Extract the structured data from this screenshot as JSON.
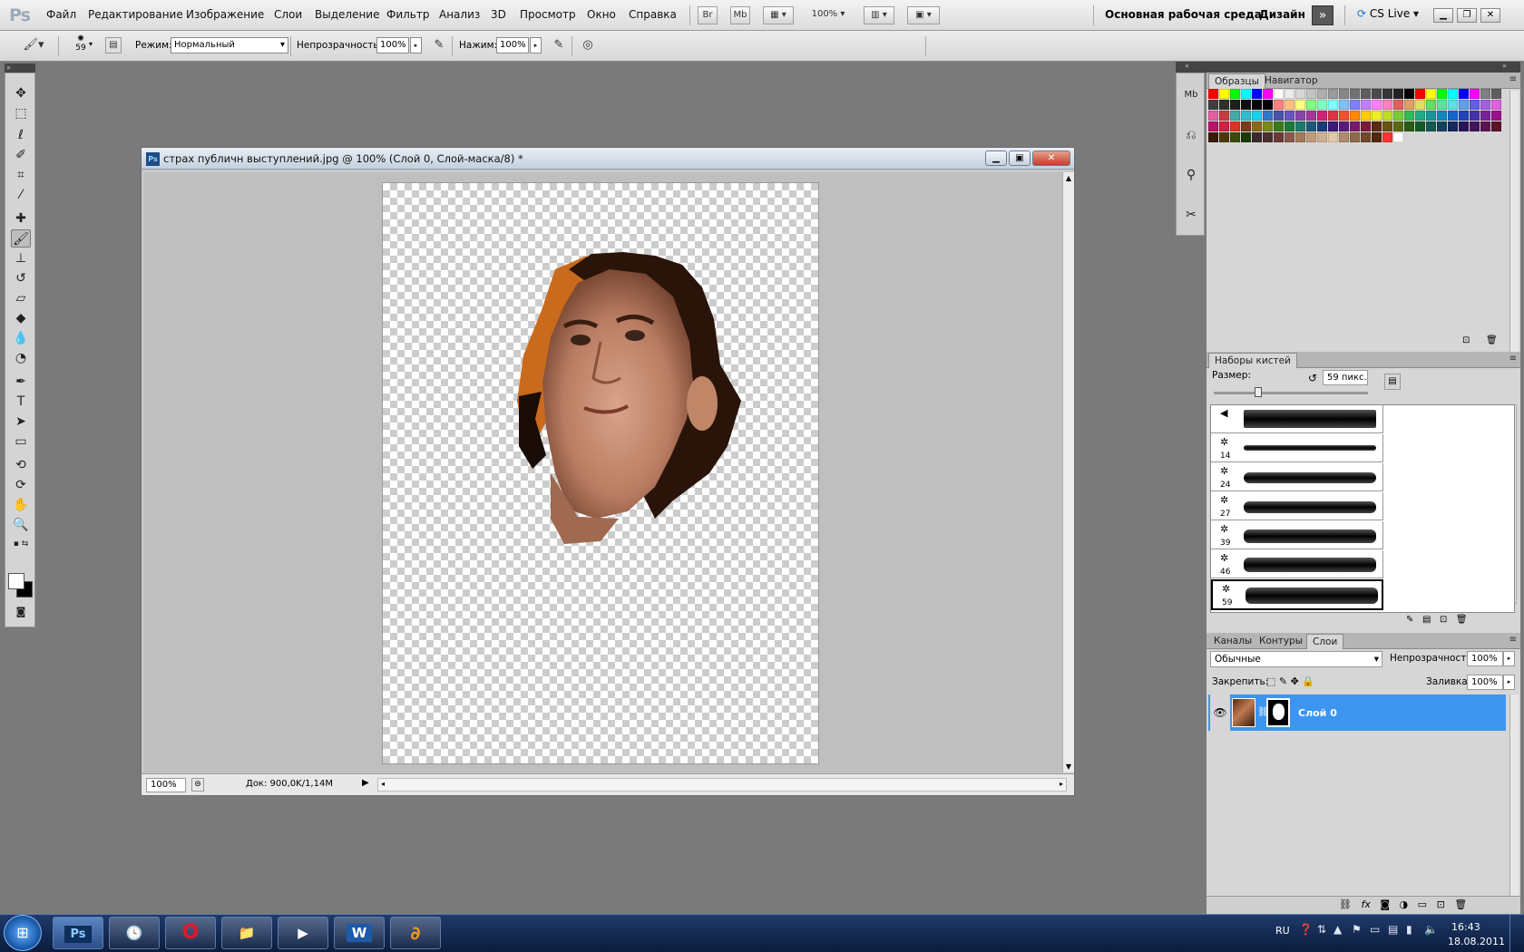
{
  "app": {
    "logo": "Ps"
  },
  "menu": [
    "Файл",
    "Редактирование",
    "Изображение",
    "Слои",
    "Выделение",
    "Фильтр",
    "Анализ",
    "3D",
    "Просмотр",
    "Окно",
    "Справка"
  ],
  "menubar_buttons": {
    "br": "Br",
    "mb": "Mb",
    "zoom": "100%"
  },
  "workspace": {
    "name": "Основная рабочая среда",
    "design": "Дизайн",
    "cslive": "CS Live"
  },
  "options": {
    "brush_size": "59",
    "mode_label": "Режим:",
    "mode_value": "Нормальный",
    "opacity_label": "Непрозрачность:",
    "opacity_value": "100%",
    "flow_label": "Нажим:",
    "flow_value": "100%"
  },
  "document": {
    "title": "страх публичн выступлений.jpg @ 100% (Слой 0, Слой-маска/8) *",
    "zoom": "100%",
    "info": "Док: 900,0K/1,14M"
  },
  "panels": {
    "swatches_tab": "Образцы",
    "navigator_tab": "Навигатор",
    "brush_presets_tab": "Наборы кистей",
    "brush_size_label": "Размер:",
    "brush_size_value": "59 пикс.",
    "brushes": [
      {
        "num": ""
      },
      {
        "num": "14"
      },
      {
        "num": "24"
      },
      {
        "num": "27"
      },
      {
        "num": "39"
      },
      {
        "num": "46"
      },
      {
        "num": "59"
      }
    ],
    "channels_tab": "Каналы",
    "paths_tab": "Контуры",
    "layers_tab": "Слои",
    "blend_mode": "Обычные",
    "opacity_label": "Непрозрачность:",
    "opacity_value": "100%",
    "lock_label": "Закрепить:",
    "fill_label": "Заливка:",
    "fill_value": "100%",
    "layer_name": "Слой 0"
  },
  "swatch_colors": [
    "#ff0000",
    "#ffff00",
    "#00ff00",
    "#00ffff",
    "#0000ff",
    "#ff00ff",
    "#ffffff",
    "#ebebeb",
    "#d7d7d7",
    "#c3c3c3",
    "#afafaf",
    "#9b9b9b",
    "#878787",
    "#737373",
    "#5f5f5f",
    "#4b4b4b",
    "#373737",
    "#232323",
    "#000000",
    "#ff0000",
    "#ffff00",
    "#00ff00",
    "#00ffff",
    "#0000ff",
    "#ff00ff",
    "#7f7f7f",
    "#5f5f5f",
    "#3f3f3f",
    "#303030",
    "#1f1f1f",
    "#0f0f0f",
    "#000000",
    "#000000",
    "#ff8080",
    "#ffc080",
    "#ffff80",
    "#80ff80",
    "#80ffc0",
    "#80ffff",
    "#80c0ff",
    "#8080ff",
    "#c080ff",
    "#ff80ff",
    "#ff80c0",
    "#e06060",
    "#e0a060",
    "#e0e060",
    "#60e060",
    "#60e0a0",
    "#60e0e0",
    "#60a0e0",
    "#6060e0",
    "#a060e0",
    "#e060e0",
    "#e060a0",
    "#c04040",
    "#44aaaa",
    "#33bbcc",
    "#22ccee",
    "#3377cc",
    "#4455aa",
    "#6655bb",
    "#8844aa",
    "#aa3399",
    "#cc2277",
    "#dd3344",
    "#ee5522",
    "#ff8800",
    "#ffcc00",
    "#eeee22",
    "#bbdd22",
    "#77cc33",
    "#33bb55",
    "#22aa88",
    "#119999",
    "#1188bb",
    "#1166cc",
    "#2244bb",
    "#4433aa",
    "#772299",
    "#991188",
    "#bb1166",
    "#cc2244",
    "#dd3322",
    "#7a3b1a",
    "#8a6a1a",
    "#7a8a1a",
    "#3a7a1a",
    "#1a7a3a",
    "#1a7a6a",
    "#1a5a7a",
    "#1a3a7a",
    "#3a1a7a",
    "#5a1a7a",
    "#7a1a6a",
    "#7a1a3a",
    "#5a2a14",
    "#6a5214",
    "#5a6a14",
    "#2a5a14",
    "#145a2a",
    "#145a52",
    "#14425a",
    "#142a5a",
    "#2a145a",
    "#42145a",
    "#5a1452",
    "#5a142a",
    "#3a1a0a",
    "#4a3a0a",
    "#3a4a0a",
    "#1a3a0a",
    "#3a2a2a",
    "#4a3030",
    "#6a3a3a",
    "#8a5a4a",
    "#a07a5a",
    "#c09a7a",
    "#d0b090",
    "#e0c8a8",
    "#b08a6a",
    "#906a4a",
    "#704a2a",
    "#502a0a",
    "#ff3333",
    "#ffffff"
  ],
  "taskbar": {
    "lang": "RU",
    "time": "16:43",
    "date": "18.08.2011",
    "ps": "Ps",
    "word": "W"
  }
}
